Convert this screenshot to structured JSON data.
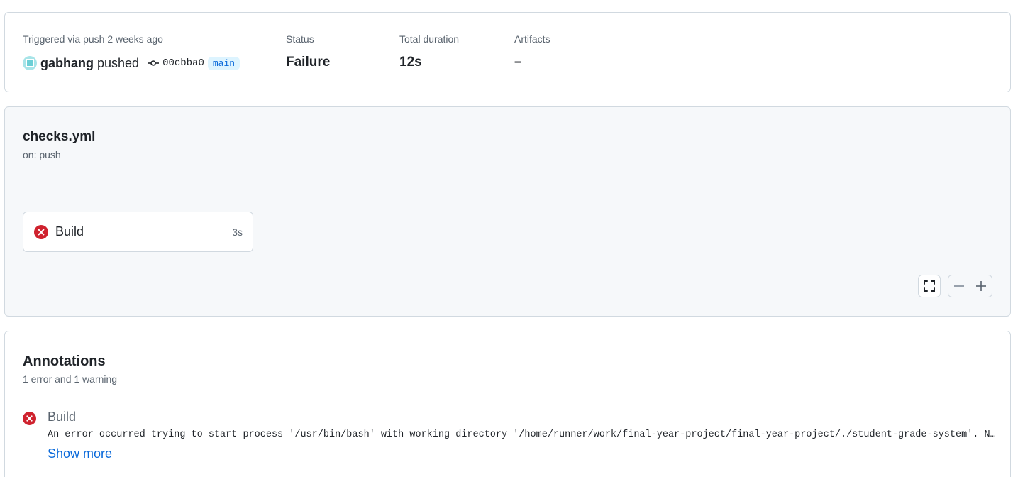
{
  "summary": {
    "trigger_label": "Triggered via push 2 weeks ago",
    "actor": "gabhang",
    "action": "pushed",
    "commit_sha": "00cbba0",
    "branch": "main",
    "status_label": "Status",
    "status_value": "Failure",
    "duration_label": "Total duration",
    "duration_value": "12s",
    "artifacts_label": "Artifacts",
    "artifacts_value": "–"
  },
  "workflow": {
    "file_name": "checks.yml",
    "trigger": "on: push",
    "jobs": [
      {
        "name": "Build",
        "duration": "3s",
        "status": "failure",
        "icon": "x-circle-fill-icon"
      }
    ],
    "controls": {
      "fullscreen_icon": "fullscreen-icon",
      "zoom_out_icon": "minus-icon",
      "zoom_in_icon": "plus-icon"
    }
  },
  "annotations": {
    "title": "Annotations",
    "summary": "1 error and 1 warning",
    "items": [
      {
        "job": "Build",
        "severity": "error",
        "icon": "x-circle-fill-icon",
        "message": "An error occurred trying to start process '/usr/bin/bash' with working directory '/home/runner/work/final-year-project/final-year-project/./student-grade-system'. No such file or directory",
        "show_more": "Show more"
      }
    ]
  },
  "colors": {
    "error": "#cf222e",
    "link": "#0969da",
    "branch_bg": "#ddf4ff",
    "border": "#d1d9e0",
    "muted": "#59636e"
  }
}
